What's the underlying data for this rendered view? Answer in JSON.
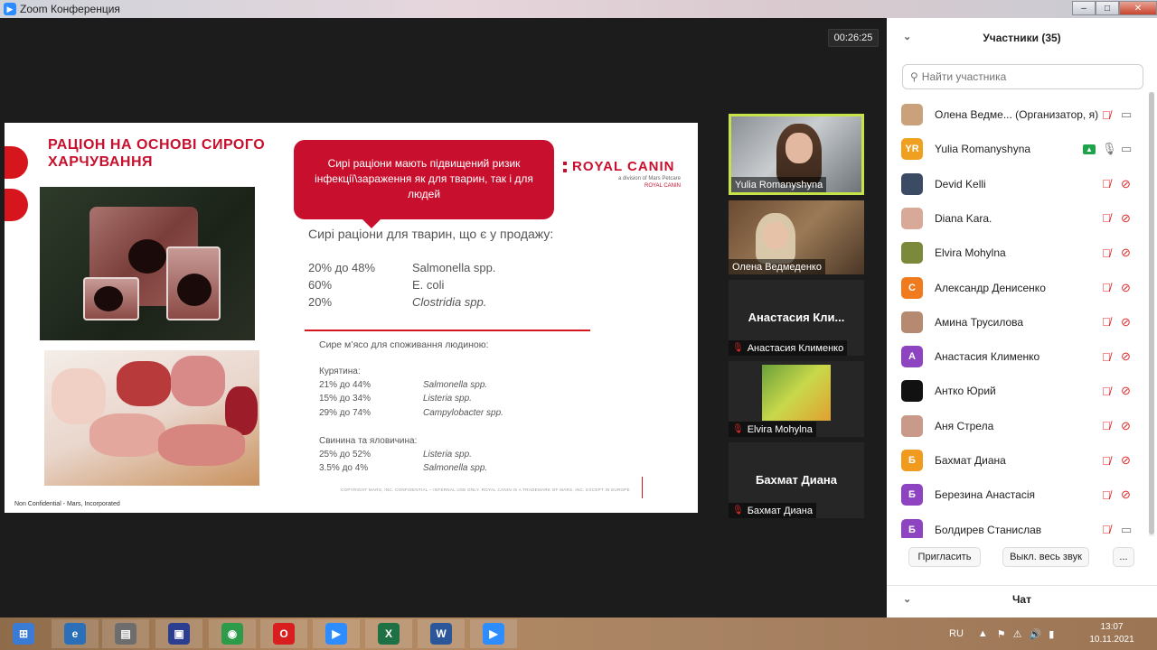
{
  "window": {
    "title": "Zoom Конференция",
    "minimize": "–",
    "maximize": "□",
    "close": "✕"
  },
  "timer": "00:26:25",
  "slide": {
    "title": "РАЦІОН НА ОСНОВІ СИРОГО ХАРЧУВАННЯ",
    "bubble": "Сирі раціони мають підвищений ризик інфекції\\зараження як для тварин, так і для людей",
    "brand": "ROYAL CANIN",
    "brand_sub": "a division of Mars Petcare",
    "brand_crown": "ROYAL CANIN",
    "sub_heading": "Сирі раціони для тварин, що є у продажу:",
    "pet_stats": [
      {
        "pct": "20% до 48%",
        "org": "Salmonella spp."
      },
      {
        "pct": "60%",
        "org": "E. coli"
      },
      {
        "pct": "20%",
        "org": "Clostridia spp."
      }
    ],
    "human_heading": "Сире м’ясо для споживання людиною:",
    "chicken_label": "Курятина:",
    "chicken_stats": [
      {
        "pct": "21% до 44%",
        "org": "Salmonella spp."
      },
      {
        "pct": "15% до 34%",
        "org": "Listeria spp."
      },
      {
        "pct": "29% до 74%",
        "org": "Campylobacter spp."
      }
    ],
    "pork_label": "Свинина та яловичина:",
    "pork_stats": [
      {
        "pct": "25% до 52%",
        "org": "Listeria spp."
      },
      {
        "pct": "3.5% до 4%",
        "org": "Salmonella spp."
      }
    ],
    "copyright": "COPYRIGHT MARS, INC. CONFIDENTIAL – INTERNAL USE ONLY. ROYAL CANIN IS A TRADEMARK OF MARS, INC. EXCEPT IN EUROPE",
    "footer": "Non Confidential - Mars, Incorporated"
  },
  "tiles": [
    {
      "name": "Yulia Romanyshyna",
      "type": "video",
      "active": true
    },
    {
      "name": "Олена Ведмеденко",
      "type": "video"
    },
    {
      "name": "Анастасия Клименко",
      "big": "Анастасия Кли...",
      "type": "name"
    },
    {
      "name": "Elvira Mohylna",
      "type": "photo"
    },
    {
      "name": "Бахмат Диана",
      "big": "Бахмат Диана",
      "type": "name"
    }
  ],
  "panel": {
    "title": "Участники (35)",
    "search_placeholder": "Найти участника",
    "participants": [
      {
        "name": "Олена Ведме...  (Организатор, я)",
        "initials": "",
        "color": "#c9a27c",
        "mic": "off",
        "cam": "gray"
      },
      {
        "name": "Yulia Romanyshyna",
        "initials": "YR",
        "color": "#f0a020",
        "mic": "on",
        "cam": "gray",
        "share": true
      },
      {
        "name": "Devid Kelli",
        "initials": "",
        "color": "#3b4b63",
        "mic": "off",
        "cam": "off"
      },
      {
        "name": "Diana Kara.",
        "initials": "",
        "color": "#d8a999",
        "mic": "off",
        "cam": "off"
      },
      {
        "name": "Elvira Mohylna",
        "initials": "",
        "color": "#7b8a3a",
        "mic": "off",
        "cam": "off"
      },
      {
        "name": "Александр Денисенко",
        "initials": "С",
        "color": "#f07a1e",
        "mic": "off",
        "cam": "off"
      },
      {
        "name": "Амина Трусилова",
        "initials": "",
        "color": "#b58a70",
        "mic": "off",
        "cam": "off"
      },
      {
        "name": "Анастасия Клименко",
        "initials": "А",
        "color": "#8e44c0",
        "mic": "off",
        "cam": "off"
      },
      {
        "name": "Антко Юрий",
        "initials": "",
        "color": "#111111",
        "mic": "off",
        "cam": "off"
      },
      {
        "name": "Аня Стрела",
        "initials": "",
        "color": "#c99a8a",
        "mic": "off",
        "cam": "off"
      },
      {
        "name": "Бахмат Диана",
        "initials": "Б",
        "color": "#f09a1e",
        "mic": "off",
        "cam": "off"
      },
      {
        "name": "Березина Анастасія",
        "initials": "Б",
        "color": "#8e44c0",
        "mic": "off",
        "cam": "off"
      },
      {
        "name": "Болдирев Станислав",
        "initials": "Б",
        "color": "#8e44c0",
        "mic": "off",
        "cam": "gray"
      }
    ],
    "invite": "Пригласить",
    "mute_all": "Выкл. весь звук",
    "more": "...",
    "chat": "Чат"
  },
  "taskbar": {
    "apps": [
      {
        "icon": "start-orb-icon",
        "glyph": "⊞",
        "color": "#3a7bd5"
      },
      {
        "icon": "ie-icon",
        "glyph": "e",
        "color": "#2a6fb8"
      },
      {
        "icon": "explorer-icon",
        "glyph": "▤",
        "color": "#6d6d6d"
      },
      {
        "icon": "save-disk-icon",
        "glyph": "▣",
        "color": "#2c3e8f"
      },
      {
        "icon": "chrome-icon",
        "glyph": "◉",
        "color": "#2e9b4a"
      },
      {
        "icon": "opera-icon",
        "glyph": "O",
        "color": "#d81e1e"
      },
      {
        "icon": "zoom-icon",
        "glyph": "▶",
        "color": "#2d8cff"
      },
      {
        "icon": "excel-icon",
        "glyph": "X",
        "color": "#1e7145"
      },
      {
        "icon": "word-icon",
        "glyph": "W",
        "color": "#2b579a"
      },
      {
        "icon": "zoom-icon",
        "glyph": "▶",
        "color": "#2d8cff"
      }
    ],
    "lang": "RU",
    "time": "13:07",
    "date": "10.11.2021"
  }
}
